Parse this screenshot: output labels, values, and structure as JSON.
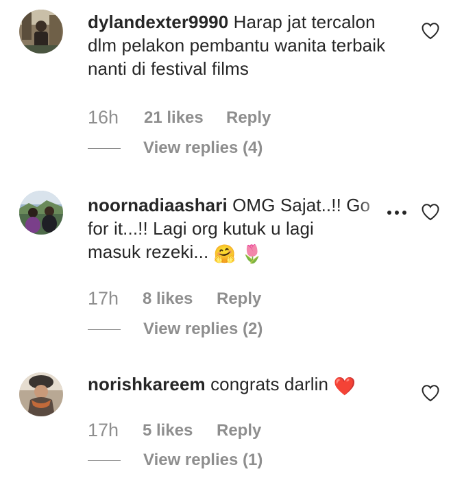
{
  "comments": [
    {
      "username": "dylandexter9990",
      "text": "Harap jat tercalon dlm pelakon pembantu wanita terbaik nanti di festival films",
      "time": "16h",
      "likes": "21 likes",
      "reply": "Reply",
      "view_replies": "View replies (4)",
      "avatar_icon": "user-avatar-photo",
      "like_icon": "heart-outline-icon"
    },
    {
      "username": "noornadiaashari",
      "text_line1": "OMG Sajat..!! Go",
      "text_line2": "for it...!! Lagi org kutuk u lagi",
      "text_line3": "masuk rezeki...",
      "emojis": [
        "🤗",
        "🌷"
      ],
      "time": "17h",
      "likes": "8 likes",
      "reply": "Reply",
      "view_replies": "View replies (2)",
      "avatar_icon": "user-avatar-photo",
      "more_icon": "more-options-icon",
      "like_icon": "heart-outline-icon"
    },
    {
      "username": "norishkareem",
      "text": "congrats darlin",
      "emoji": "❤️",
      "time": "17h",
      "likes": "5 likes",
      "reply": "Reply",
      "view_replies": "View replies (1)",
      "avatar_icon": "user-avatar-photo",
      "like_icon": "heart-outline-icon"
    }
  ],
  "colors": {
    "text": "#262626",
    "secondary": "#8e8e8e",
    "heart_red": "#ed4956"
  }
}
